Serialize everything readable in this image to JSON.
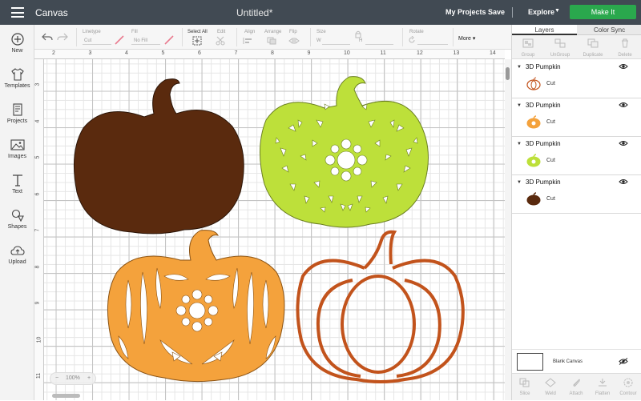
{
  "header": {
    "app_title": "Canvas",
    "doc_title": "Untitled*",
    "my_projects": "My Projects",
    "save": "Save",
    "separator": "|",
    "explore": "Explore",
    "make_it": "Make It",
    "make_it_color": "#2aa84d"
  },
  "sidebar": {
    "items": [
      {
        "label": "New",
        "icon": "plus-circle-icon"
      },
      {
        "label": "Templates",
        "icon": "shirt-icon"
      },
      {
        "label": "Projects",
        "icon": "projects-icon"
      },
      {
        "label": "Images",
        "icon": "image-icon"
      },
      {
        "label": "Text",
        "icon": "text-icon"
      },
      {
        "label": "Shapes",
        "icon": "shapes-icon"
      },
      {
        "label": "Upload",
        "icon": "upload-cloud-icon"
      }
    ]
  },
  "toolbar": {
    "linetype_label": "Linetype",
    "linetype_value": "Cut",
    "fill_label": "Fill",
    "fill_value": "No Fill",
    "select_all": "Select All",
    "edit": "Edit",
    "align": "Align",
    "arrange": "Arrange",
    "flip": "Flip",
    "size": "Size",
    "size_w": "W",
    "size_h": "H",
    "rotate": "Rotate",
    "more": "More"
  },
  "rulers": {
    "top": [
      "2",
      "3",
      "4",
      "5",
      "6",
      "7",
      "8",
      "9",
      "10",
      "11",
      "12",
      "13",
      "14"
    ],
    "left": [
      "3",
      "4",
      "5",
      "6",
      "7",
      "8",
      "9",
      "10",
      "11"
    ]
  },
  "canvas": {
    "zoom_out": "−",
    "zoom_level": "100%",
    "zoom_in": "+",
    "shape_colors": {
      "brown_pumpkin": "#5a2a0e",
      "green_pumpkin": "#bde03a",
      "orange_pumpkin": "#f4a23c",
      "outline_pumpkin": "#c2531c"
    }
  },
  "panel": {
    "tabs": [
      "Layers",
      "Color Sync"
    ],
    "tools": [
      "Group",
      "UnGroup",
      "Duplicate",
      "Delete"
    ],
    "layers": [
      {
        "name": "3D Pumpkin",
        "op": "Cut",
        "color": "#c2531c",
        "thumb": "outline"
      },
      {
        "name": "3D Pumpkin",
        "op": "Cut",
        "color": "#f4a23c",
        "thumb": "filled-pattern"
      },
      {
        "name": "3D Pumpkin",
        "op": "Cut",
        "color": "#bde03a",
        "thumb": "filled-pattern"
      },
      {
        "name": "3D Pumpkin",
        "op": "Cut",
        "color": "#5a2a0e",
        "thumb": "solid"
      }
    ],
    "blank_canvas": "Blank Canvas",
    "bottom_tools": [
      "Slice",
      "Weld",
      "Attach",
      "Flatten",
      "Contour"
    ]
  }
}
